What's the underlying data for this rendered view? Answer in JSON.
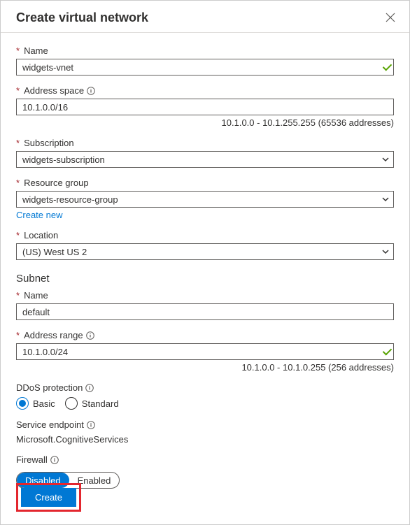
{
  "header": {
    "title": "Create virtual network"
  },
  "fields": {
    "name": {
      "label": "Name",
      "value": "widgets-vnet"
    },
    "address_space": {
      "label": "Address space",
      "value": "10.1.0.0/16",
      "helper": "10.1.0.0 - 10.1.255.255 (65536 addresses)"
    },
    "subscription": {
      "label": "Subscription",
      "value": "widgets-subscription"
    },
    "resource_group": {
      "label": "Resource group",
      "value": "widgets-resource-group",
      "create_new": "Create new"
    },
    "location": {
      "label": "Location",
      "value": "(US) West US 2"
    }
  },
  "subnet": {
    "title": "Subnet",
    "name": {
      "label": "Name",
      "value": "default"
    },
    "range": {
      "label": "Address range",
      "value": "10.1.0.0/24",
      "helper": "10.1.0.0 - 10.1.0.255 (256 addresses)"
    }
  },
  "ddos": {
    "label": "DDoS protection",
    "options": {
      "basic": "Basic",
      "standard": "Standard"
    }
  },
  "service_endpoint": {
    "label": "Service endpoint",
    "value": "Microsoft.CognitiveServices"
  },
  "firewall": {
    "label": "Firewall",
    "disabled": "Disabled",
    "enabled": "Enabled"
  },
  "footer": {
    "create": "Create"
  }
}
